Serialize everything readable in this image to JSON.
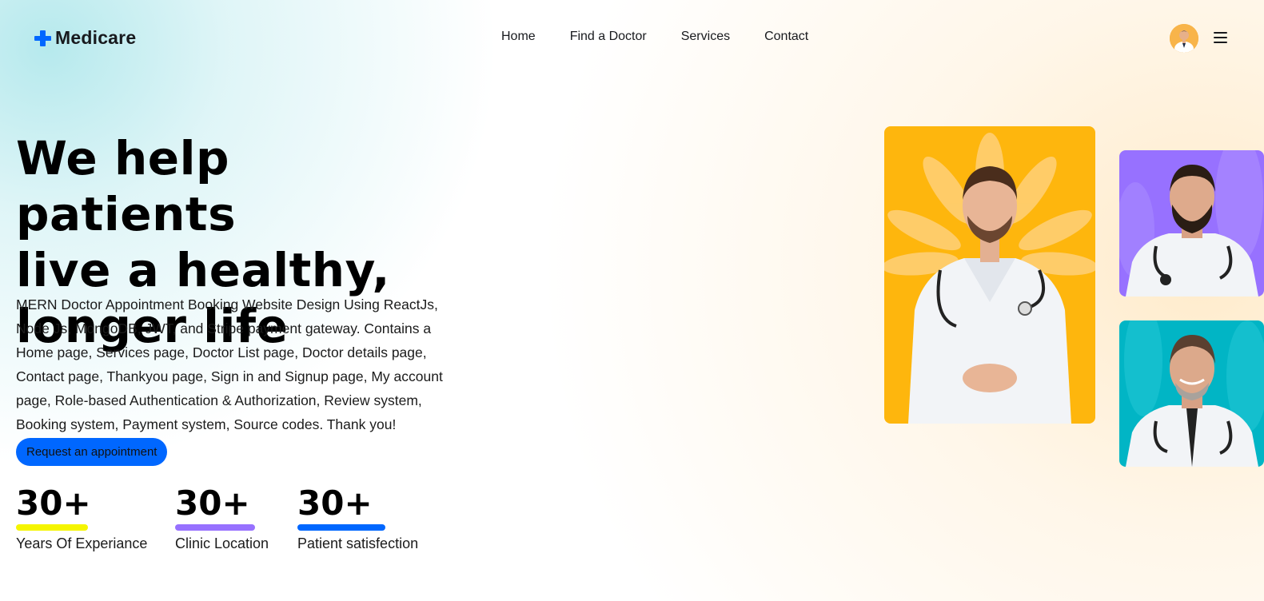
{
  "brand": {
    "name": "Medicare",
    "accent": "#0067ff"
  },
  "nav": {
    "items": [
      "Home",
      "Find a Doctor",
      "Services",
      "Contact"
    ]
  },
  "header": {
    "avatar_icon": "user-avatar",
    "menu_icon": "hamburger-menu-icon"
  },
  "hero": {
    "title_line1": "We help patients",
    "title_line2": "live a healthy,",
    "title_line3": "longer life",
    "description": "MERN Doctor Appointment Booking Website Design Using ReactJs, Node Js, MongoDB, JWT, and Stripe payment gateway. Contains a Home page, Services page, Doctor List page, Doctor details page, Contact page, Thankyou page, Sign in and Signup page, My account page, Role-based Authentication & Authorization, Review system, Booking system, Payment system, Source codes. Thank you!",
    "cta_label": "Request an appointment"
  },
  "stats": [
    {
      "value": "30+",
      "label": "Years Of Experiance",
      "color": "#f5f500"
    },
    {
      "value": "30+",
      "label": "Clinic Location",
      "color": "#9771ff"
    },
    {
      "value": "30+",
      "label": "Patient satisfection",
      "color": "#0067ff"
    }
  ],
  "doctor_images": [
    {
      "background": "#feb60d",
      "name": "doctor-photo-yellow"
    },
    {
      "background": "#9771ff",
      "name": "doctor-photo-purple"
    },
    {
      "background": "#01b5c5",
      "name": "doctor-photo-teal"
    }
  ]
}
